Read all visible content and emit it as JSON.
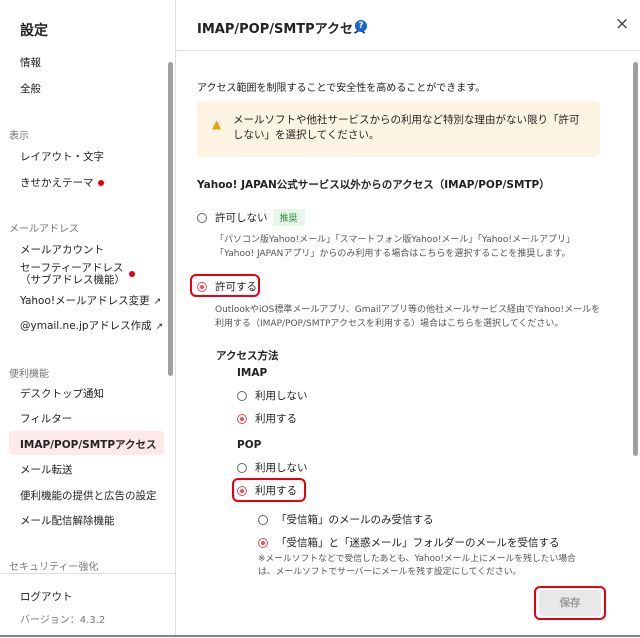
{
  "sidebar": {
    "title": "設定",
    "items_top": [
      "情報",
      "全般"
    ],
    "display_header": "表示",
    "display_items": [
      "レイアウト・文字",
      "きせかえテーマ"
    ],
    "address_header": "メールアドレス",
    "address_items": [
      "メールアカウント",
      "セーフティーアドレス",
      "（サブアドレス機能）",
      "Yahoo!メールアドレス変更",
      "@ymail.ne.jpアドレス作成"
    ],
    "convenience_header": "便利機能",
    "convenience_items": [
      "デスクトップ通知",
      "フィルター",
      "IMAP/POP/SMTPアクセス",
      "メール転送",
      "便利機能の提供と広告の設定",
      "メール配信解除機能"
    ],
    "security_header": "セキュリティー強化",
    "logout": "ログアウト",
    "version": "バージョン：4.3.2"
  },
  "main": {
    "title": "IMAP/POP/SMTPアクセス",
    "help": "?",
    "close": "×",
    "intro": "アクセス範囲を制限することで安全性を高めることができます。",
    "warning": "メールソフトや他社サービスからの利用など特別な理由がない限り「許可しない」を選択してください。",
    "section_title": "Yahoo! JAPAN公式サービス以外からのアクセス（IMAP/POP/SMTP）",
    "deny_label": "許可しない",
    "recommended": "推奨",
    "deny_desc": "「パソコン版Yahoo!メール」「スマートフォン版Yahoo!メール」「Yahoo!メールアプリ」「Yahoo! JAPANアプリ」からのみ利用する場合はこちらを選択することを推奨します。",
    "allow_label": "許可する",
    "allow_desc": "OutlookやiOS標準メールアプリ、Gmailアプリ等の他社メールサービス経由でYahoo!メールを利用する（IMAP/POP/SMTPアクセスを利用する）場合はこちらを選択してください。",
    "method_title": "アクセス方法",
    "imap_title": "IMAP",
    "imap_off": "利用しない",
    "imap_on": "利用する",
    "pop_title": "POP",
    "pop_off": "利用しない",
    "pop_on": "利用する",
    "pop_inbox_only": "「受信箱」のメールのみ受信する",
    "pop_inbox_spam": "「受信箱」と「迷惑メール」フォルダーのメールを受信する",
    "pop_note": "※メールソフトなどで受信したあとも、Yahoo!メール上にメールを残したい場合は、メールソフトでサーバーにメールを残す設定にしてください。",
    "save": "保存"
  },
  "colors": {
    "accent": "#e8505b",
    "annotation": "#e60012",
    "warning_bg": "#fdf3e3",
    "selected_bg": "#fde9ea",
    "badge_bg": "#e6f7e9",
    "badge_text": "#2e8b3d"
  }
}
